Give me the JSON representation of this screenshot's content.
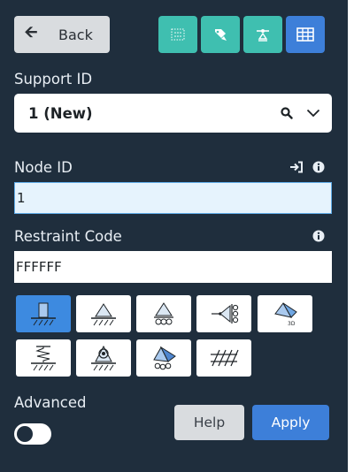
{
  "toolbar": {
    "back_label": "Back",
    "tools": [
      {
        "icon": "grid-dots-icon",
        "color": "#3fbfb0"
      },
      {
        "icon": "tag-pin-icon",
        "color": "#3fbfb0"
      },
      {
        "icon": "support-node-icon",
        "color": "#3fbfb0"
      },
      {
        "icon": "table-icon",
        "color": "#3d7fd9"
      }
    ]
  },
  "support_id": {
    "label": "Support ID",
    "value": "1 (New)"
  },
  "node_id": {
    "label": "Node ID",
    "value": "1"
  },
  "restraint_code": {
    "label": "Restraint Code",
    "value": "FFFFFF"
  },
  "support_types": [
    {
      "icon": "fixed-support-icon",
      "active": true
    },
    {
      "icon": "pinned-support-icon",
      "active": false
    },
    {
      "icon": "roller-support-icon",
      "active": false
    },
    {
      "icon": "side-roller-support-icon",
      "active": false
    },
    {
      "icon": "support-3d-icon",
      "active": false,
      "label": "3D"
    },
    {
      "icon": "spring-support-icon",
      "active": false
    },
    {
      "icon": "rotational-spring-support-icon",
      "active": false
    },
    {
      "icon": "inclined-roller-support-icon",
      "active": false
    },
    {
      "icon": "hatched-ground-icon",
      "active": false
    }
  ],
  "advanced": {
    "label": "Advanced",
    "enabled": false
  },
  "actions": {
    "help_label": "Help",
    "apply_label": "Apply"
  },
  "colors": {
    "panel_bg": "#1f2e3d",
    "accent_blue": "#3d7fd9",
    "accent_teal": "#3fbfb0"
  }
}
